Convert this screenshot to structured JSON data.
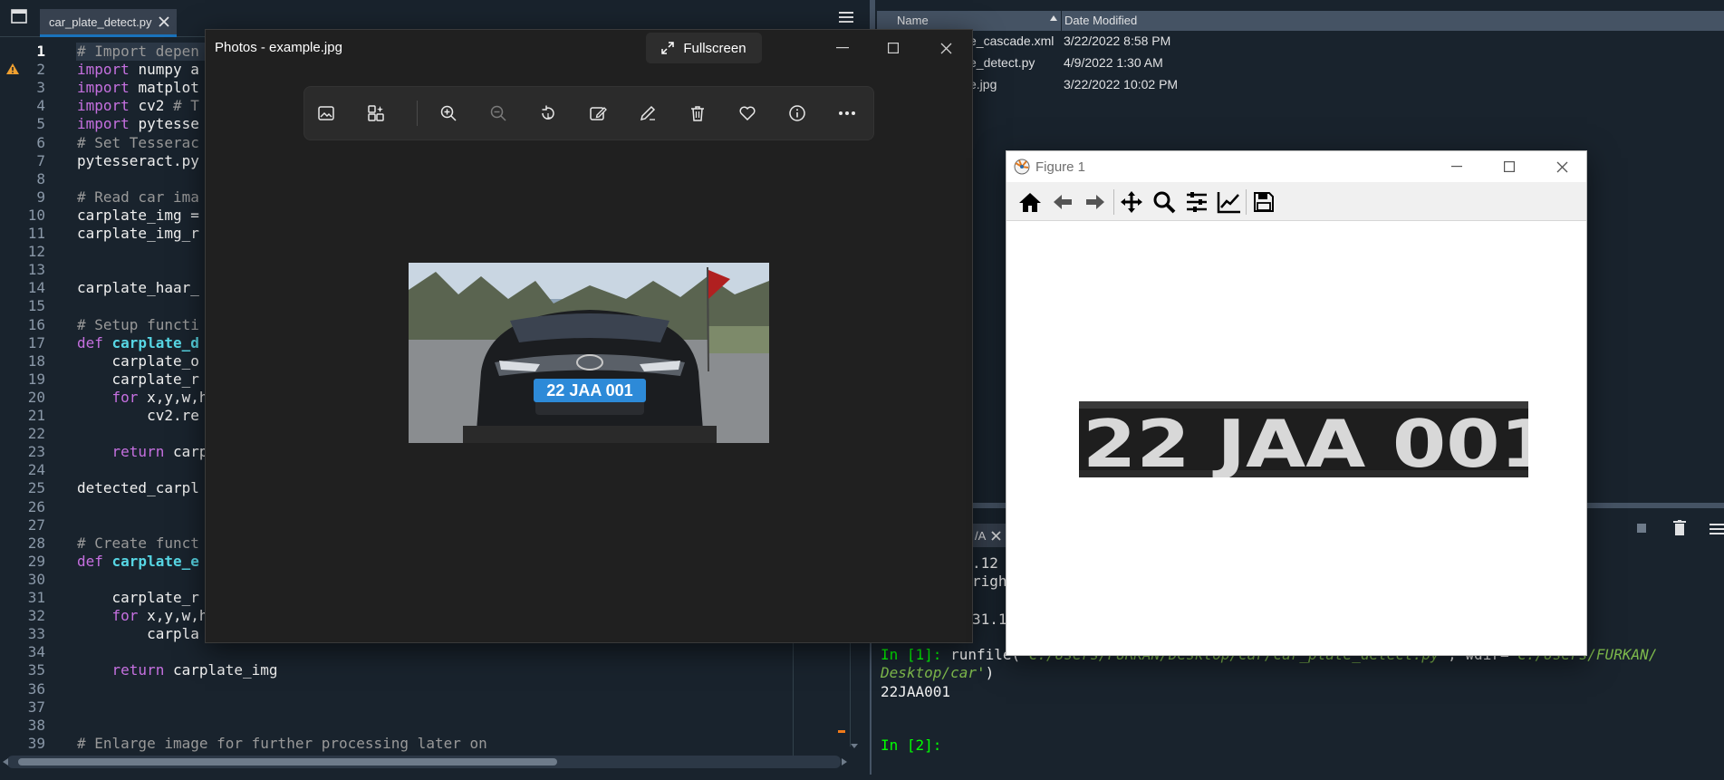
{
  "editor": {
    "tab_label": "car_plate_detect.py",
    "lines": [
      {
        "n": "1",
        "text": "# Import depen"
      },
      {
        "n": "2",
        "text": "import numpy a"
      },
      {
        "n": "3",
        "text": "import matplot"
      },
      {
        "n": "4",
        "text": "import cv2 # T"
      },
      {
        "n": "5",
        "text": "import pytesse"
      },
      {
        "n": "6",
        "text": "# Set Tesserac"
      },
      {
        "n": "7",
        "text": "pytesseract.py"
      },
      {
        "n": "8",
        "text": ""
      },
      {
        "n": "9",
        "text": "# Read car ima"
      },
      {
        "n": "10",
        "text": "carplate_img ="
      },
      {
        "n": "11",
        "text": "carplate_img_r"
      },
      {
        "n": "12",
        "text": ""
      },
      {
        "n": "13",
        "text": ""
      },
      {
        "n": "14",
        "text": "carplate_haar_"
      },
      {
        "n": "15",
        "text": ""
      },
      {
        "n": "16",
        "text": "# Setup functi"
      },
      {
        "n": "17",
        "kw": "def ",
        "fn": "carplate_d"
      },
      {
        "n": "18",
        "text": "    carplate_o"
      },
      {
        "n": "19",
        "text": "    carplate_r"
      },
      {
        "n": "20",
        "kw": "    for ",
        "text": "x,y,w,h"
      },
      {
        "n": "21",
        "text": "        cv2.re"
      },
      {
        "n": "22",
        "text": ""
      },
      {
        "n": "23",
        "kw": "    return ",
        "text": "carp"
      },
      {
        "n": "24",
        "text": ""
      },
      {
        "n": "25",
        "text": "detected_carpl"
      },
      {
        "n": "26",
        "text": ""
      },
      {
        "n": "27",
        "text": ""
      },
      {
        "n": "28",
        "text": "# Create funct"
      },
      {
        "n": "29",
        "kw": "def ",
        "fn": "carplate_e"
      },
      {
        "n": "30",
        "text": ""
      },
      {
        "n": "31",
        "text": "    carplate_r"
      },
      {
        "n": "32",
        "kw": "    for ",
        "text": "x,y,w,h"
      },
      {
        "n": "33",
        "text": "        carpla"
      },
      {
        "n": "34",
        "text": ""
      },
      {
        "n": "35",
        "kw": "    return ",
        "text": "carplate_img"
      },
      {
        "n": "36",
        "text": ""
      },
      {
        "n": "37",
        "text": ""
      },
      {
        "n": "38",
        "text": ""
      },
      {
        "n": "39",
        "text": "# Enlarge image for further processing later on"
      }
    ]
  },
  "files": {
    "col_name": "Name",
    "col_date": "Date Modified",
    "rows": [
      {
        "name": "e_cascade.xml",
        "date": "3/22/2022 8:58 PM"
      },
      {
        "name": "e_detect.py",
        "date": "4/9/2022 1:30 AM"
      },
      {
        "name": "e.jpg",
        "date": "3/22/2022 10:02 PM"
      }
    ]
  },
  "console": {
    "tab_label": "/A",
    "frag1": ".12",
    "frag2": "righ",
    "frag3": "31.1",
    "in1_prompt": "In [1]:",
    "in1_cmd": " runfile(",
    "in1_path1": "'C:/Users/FURKAN/Desktop/car/car_plate_detect.py'",
    "in1_mid": ", wdir=",
    "in1_path2a": "'C:/Users/FURKAN/",
    "in1_path2b": "Desktop/car'",
    "in1_end": ")",
    "output": "22JAA001",
    "in2_prompt": "In [2]:"
  },
  "photos": {
    "title": "Photos - example.jpg",
    "fullscreen_label": "Fullscreen",
    "plate_text": "22 JAA 001"
  },
  "figure": {
    "title": "Figure 1",
    "plate_text": "22 JAA 001"
  }
}
